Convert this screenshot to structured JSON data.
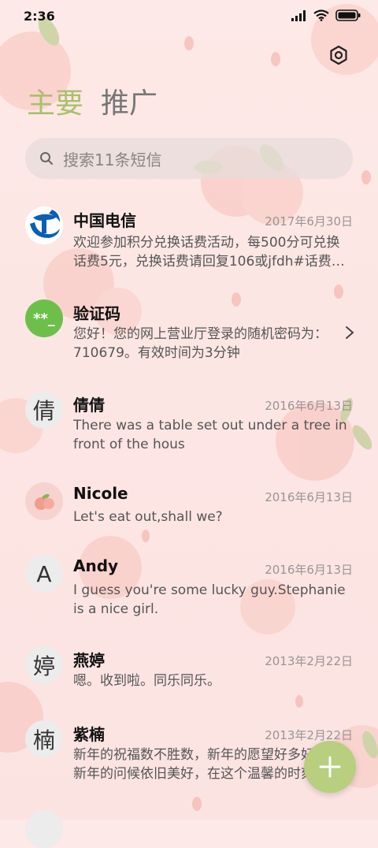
{
  "status_bar": {
    "time": "2:36"
  },
  "tabs": [
    {
      "label": "主要"
    },
    {
      "label": "推广"
    }
  ],
  "search": {
    "placeholder": "搜索11条短信"
  },
  "messages": [
    {
      "name": "中国电信",
      "date": "2017年6月30日",
      "preview": "欢迎参加积分兑换话费活动，每500分可兑换话费5元，兑换话费请回复106或jfdh#话费…",
      "avatar": "telecom-logo"
    },
    {
      "name": "验证码",
      "date": "",
      "preview": "您好！您的网上营业厅登录的随机密码为：710679。有效时间为3分钟",
      "avatar": "**_"
    },
    {
      "name": "倩倩",
      "date": "2016年6月13日",
      "preview": "There was a table set out under a tree in front of the hous",
      "avatar": "倩"
    },
    {
      "name": "Nicole",
      "date": "2016年6月13日",
      "preview": "Let's eat out,shall we?",
      "avatar": "peach-picture"
    },
    {
      "name": "Andy",
      "date": "2016年6月13日",
      "preview": "I guess you're some lucky guy.Stephanie is a nice girl.",
      "avatar": "A"
    },
    {
      "name": "燕婷",
      "date": "2013年2月22日",
      "preview": "嗯。收到啦。同乐同乐。",
      "avatar": "婷"
    },
    {
      "name": "紫楠",
      "date": "2013年2月22日",
      "preview": "新年的祝福数不胜数，新年的愿望好多好多，新年的问候依旧美好，在这个温馨的时刻",
      "avatar": "楠"
    }
  ],
  "colors": {
    "accent": "#a9c06d",
    "fab": "#b7cf7e",
    "verify_avatar": "#6cc04a",
    "telecom_blue": "#0a5fb4"
  },
  "icons": {
    "settings": "settings-icon",
    "search": "search-icon",
    "fab": "plus-icon",
    "row_arrow": "chevron-right-icon"
  }
}
